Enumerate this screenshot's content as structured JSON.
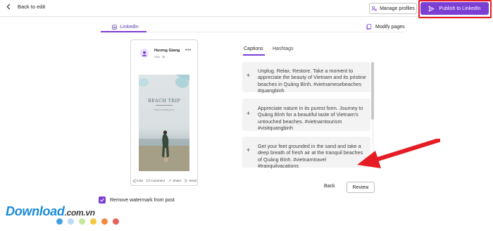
{
  "topbar": {
    "back_label": "Back to edit",
    "manage_label": "Manage profiles",
    "publish_label": "Publish to LinkedIn"
  },
  "tabs": {
    "linkedin_label": "LinkedIn",
    "modify_label": "Modify pages"
  },
  "preview": {
    "author": "Hương Giang",
    "meta": "Now · ◍",
    "image_title": "BEACH TRIP",
    "image_subtitle": "PHOTO PORTFOLIO",
    "actions": [
      "Like",
      "Comment",
      "Share",
      "Send"
    ]
  },
  "captions_panel": {
    "tab_captions": "Captions",
    "tab_hashtags": "Hashtags",
    "items": [
      "Unplug. Relax. Restore. Take a moment to appreciate the beauty of Vietnam and its pristine beaches in Quảng Bình. #vietnamesebeaches #quangbinh",
      "Appreciate nature in its purest form. Journey to Quảng Bình for a beautiful taste of Vietnam's untouched beaches. #vietnamtourism #visitquangbinh",
      "Get your feet grounded in the sand and take a deep breath of fresh air at the tranquil beaches of Quảng Bình. #vietnamtravel #tranquilvacations"
    ]
  },
  "footer": {
    "back_label": "Back",
    "review_label": "Review",
    "watermark_label": "Remove watermark from post",
    "watermark_checked": true
  },
  "watermark_logo": {
    "text": "Download",
    "suffix": ".com.vn",
    "dot_colors": [
      "#3ea0e6",
      "#b9dcf5",
      "#c7e89c",
      "#f5c842",
      "#f08a3c",
      "#e8605a"
    ]
  },
  "colors": {
    "accent": "#7b3fd4",
    "highlight_red": "#e51c23"
  }
}
